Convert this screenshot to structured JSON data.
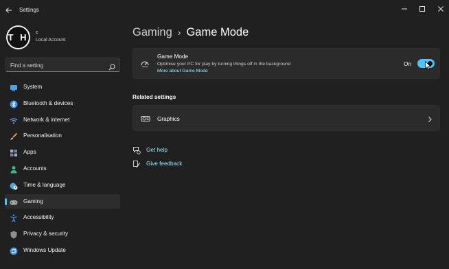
{
  "window": {
    "title": "Settings"
  },
  "account": {
    "initials": "T H",
    "name": "c",
    "type": "Local Account"
  },
  "search": {
    "placeholder": "Find a setting"
  },
  "sidebar": {
    "items": [
      {
        "label": "System",
        "icon": "monitor-icon",
        "color": "#4aa3e8"
      },
      {
        "label": "Bluetooth & devices",
        "icon": "bluetooth-icon",
        "color": "#3b8ff0"
      },
      {
        "label": "Network & internet",
        "icon": "wifi-icon",
        "color": "#5aa0e0"
      },
      {
        "label": "Personalisation",
        "icon": "brush-icon",
        "color": "#e09a4a"
      },
      {
        "label": "Apps",
        "icon": "apps-icon",
        "color": "#9ab0c8"
      },
      {
        "label": "Accounts",
        "icon": "person-icon",
        "color": "#3fb58f"
      },
      {
        "label": "Time & language",
        "icon": "globe-clock-icon",
        "color": "#4aa3e8"
      },
      {
        "label": "Gaming",
        "icon": "gamepad-icon",
        "color": "#a9a9a9",
        "active": true
      },
      {
        "label": "Accessibility",
        "icon": "accessibility-icon",
        "color": "#3b8ff0"
      },
      {
        "label": "Privacy & security",
        "icon": "shield-icon",
        "color": "#8f8f8f"
      },
      {
        "label": "Windows Update",
        "icon": "sync-icon",
        "color": "#3b8ff0"
      }
    ]
  },
  "breadcrumb": {
    "parent": "Gaming",
    "separator": "›",
    "current": "Game Mode"
  },
  "game_mode": {
    "title": "Game Mode",
    "description": "Optimise your PC for play by turning things off in the background",
    "link": "More about Game Mode",
    "toggle_label": "On",
    "toggle_on": true
  },
  "related": {
    "heading": "Related settings",
    "items": [
      {
        "label": "Graphics"
      }
    ]
  },
  "help": {
    "get_help": "Get help",
    "give_feedback": "Give feedback"
  },
  "colors": {
    "accent": "#4cc2ff",
    "link": "#99ebff",
    "background": "#202020",
    "card": "#2b2b2b"
  }
}
